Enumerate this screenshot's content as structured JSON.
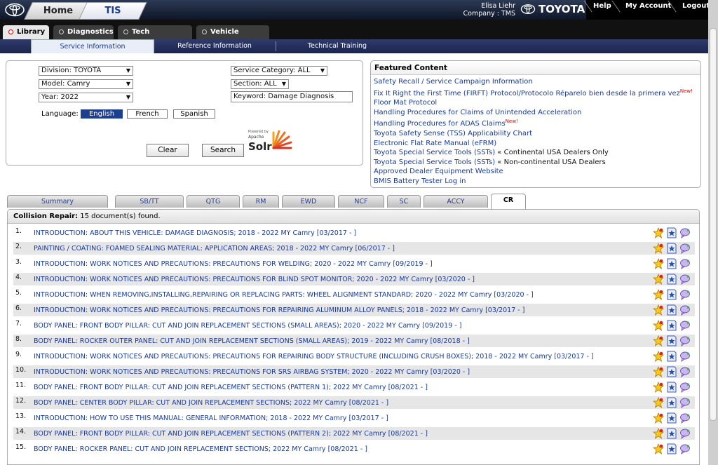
{
  "header": {
    "home_tab": "Home",
    "tis_tab": "TIS",
    "user_name": "Elisa Liehr",
    "company": "Company : TMS",
    "brand": "TOYOTA",
    "links": [
      "Help",
      "My Account",
      "Logout"
    ]
  },
  "subnav": {
    "tabs": [
      {
        "label": "Library",
        "active": true
      },
      {
        "label": "Diagnostics",
        "active": false
      },
      {
        "label": "Tech Assistance",
        "active": false
      },
      {
        "label": "Vehicle Inquiry",
        "active": false
      }
    ]
  },
  "infonav": {
    "tabs": [
      {
        "label": "Service Information",
        "active": true
      },
      {
        "label": "Reference Information",
        "active": false
      },
      {
        "label": "Technical Training",
        "active": false
      }
    ]
  },
  "search": {
    "division": "Division: TOYOTA",
    "model": "Model: Camry",
    "year": "Year: 2022",
    "service_category": "Service Category: ALL",
    "section": "Section: ALL",
    "keyword_label": "Keyword:",
    "keyword_value": "Damage Diagnosis",
    "language_label": "Language:",
    "languages": [
      "English",
      "French",
      "Spanish"
    ],
    "selected_language": "English",
    "clear_label": "Clear",
    "search_label": "Search",
    "solr_powered": "Powered by",
    "solr_apache": "Apache",
    "solr_name": "Solr"
  },
  "featured": {
    "title": "Featured Content",
    "items": [
      {
        "text": "Safety Recall / Service Campaign Information",
        "new": "",
        "note": ""
      },
      {
        "text": "Fix It Right the First Time (FIRFT) Protocol/Protocolo Réparelo bien desde la primera vez",
        "new": "New!",
        "note": ""
      },
      {
        "text": "Floor Mat Protocol",
        "new": "",
        "note": ""
      },
      {
        "text": "Handling Procedures for Claims of Unintended Acceleration",
        "new": "",
        "note": ""
      },
      {
        "text": "Handling Procedures for ADAS Claims",
        "new": "New!",
        "note": ""
      },
      {
        "text": "Toyota Safety Sense (TSS) Applicability Chart",
        "new": "",
        "note": ""
      },
      {
        "text": "Electronic Flat Rate Manual (eFRM)",
        "new": "",
        "note": ""
      },
      {
        "text": "Toyota Special Service Tools (SSTs)",
        "new": "",
        "note": " « Continental USA Dealers Only"
      },
      {
        "text": "Toyota Special Service Tools (SSTs)",
        "new": "",
        "note": " « Non-continental USA Dealers"
      },
      {
        "text": "Approved Dealer Equipment Website",
        "new": "",
        "note": ""
      },
      {
        "text": "BMIS Battery Tester Log in",
        "new": "",
        "note": ""
      }
    ]
  },
  "result_tabs": [
    "Summary",
    "SB/TT",
    "QTG",
    "RM",
    "EWD",
    "NCF",
    "SC",
    "ACCY",
    "CR"
  ],
  "active_result_tab": "CR",
  "results": {
    "category": "Collision Repair:",
    "count_text": "15 document(s) found.",
    "rows": [
      {
        "num": "1.",
        "title": "INTRODUCTION: ABOUT THIS VEHICLE: DAMAGE DIAGNOSIS; 2018 - 2022 MY Camry [03/2017 - ]"
      },
      {
        "num": "2.",
        "title": "PAINTING / COATING: FOAMED SEALING MATERIAL: APPLICATION AREAS; 2018 - 2022 MY Camry [06/2017 - ]"
      },
      {
        "num": "3.",
        "title": "INTRODUCTION: WORK NOTICES AND PRECAUTIONS: PRECAUTIONS FOR WELDING; 2020 - 2022 MY Camry [09/2019 - ]"
      },
      {
        "num": "4.",
        "title": "INTRODUCTION: WORK NOTICES AND PRECAUTIONS: PRECAUTIONS FOR BLIND SPOT MONITOR; 2020 - 2022 MY Camry [03/2020 - ]"
      },
      {
        "num": "5.",
        "title": "INTRODUCTION: WHEN REMOVING,INSTALLING,REPAIRING OR REPLACING PARTS: WHEEL ALIGNMENT STANDARD; 2020 - 2022 MY Camry [03/2020 - ]"
      },
      {
        "num": "6.",
        "title": "INTRODUCTION: WORK NOTICES AND PRECAUTIONS: PRECAUTIONS FOR REPAIRING ALUMINUM ALLOY PANELS; 2018 - 2022 MY Camry [03/2017 - ]"
      },
      {
        "num": "7.",
        "title": "BODY PANEL: FRONT BODY PILLAR: CUT AND JOIN REPLACEMENT SECTIONS (SMALL AREAS); 2020 - 2022 MY Camry [09/2019 - ]"
      },
      {
        "num": "8.",
        "title": "BODY PANEL: ROCKER OUTER PANEL: CUT AND JOIN REPLACEMENT SECTIONS (SMALL AREAS); 2019 - 2022 MY Camry [08/2018 - ]"
      },
      {
        "num": "9.",
        "title": "INTRODUCTION: WORK NOTICES AND PRECAUTIONS: PRECAUTIONS FOR REPAIRING BODY STRUCTURE (INCLUDING CRUSH BOXES); 2018 - 2022 MY Camry [03/2017 - ]"
      },
      {
        "num": "10.",
        "title": "INTRODUCTION: WORK NOTICES AND PRECAUTIONS: PRECAUTIONS FOR SRS AIRBAG SYSTEM; 2020 - 2022 MY Camry [03/2020 - ]"
      },
      {
        "num": "11.",
        "title": "BODY PANEL: FRONT BODY PILLAR: CUT AND JOIN REPLACEMENT SECTIONS (PATTERN 1); 2022 MY Camry [08/2021 - ]"
      },
      {
        "num": "12.",
        "title": "BODY PANEL: CENTER BODY PILLAR: CUT AND JOIN REPLACEMENT SECTIONS; 2022 MY Camry [08/2021 - ]"
      },
      {
        "num": "13.",
        "title": "INTRODUCTION: HOW TO USE THIS MANUAL: GENERAL INFORMATION; 2018 - 2022 MY Camry [03/2017 - ]"
      },
      {
        "num": "14.",
        "title": "BODY PANEL: FRONT BODY PILLAR: CUT AND JOIN REPLACEMENT SECTIONS (PATTERN 2); 2022 MY Camry [08/2021 - ]"
      },
      {
        "num": "15.",
        "title": "BODY PANEL: ROCKER PANEL: CUT AND JOIN REPLACEMENT SECTIONS; 2022 MY Camry [08/2021 - ]"
      }
    ],
    "row_icons": [
      "favorite-star-icon",
      "bookmark-star-icon",
      "comment-bubble-icon"
    ]
  },
  "colors": {
    "link": "#1a3a9a",
    "active_language": "#1c3f8f",
    "new_badge": "#dd0000"
  }
}
